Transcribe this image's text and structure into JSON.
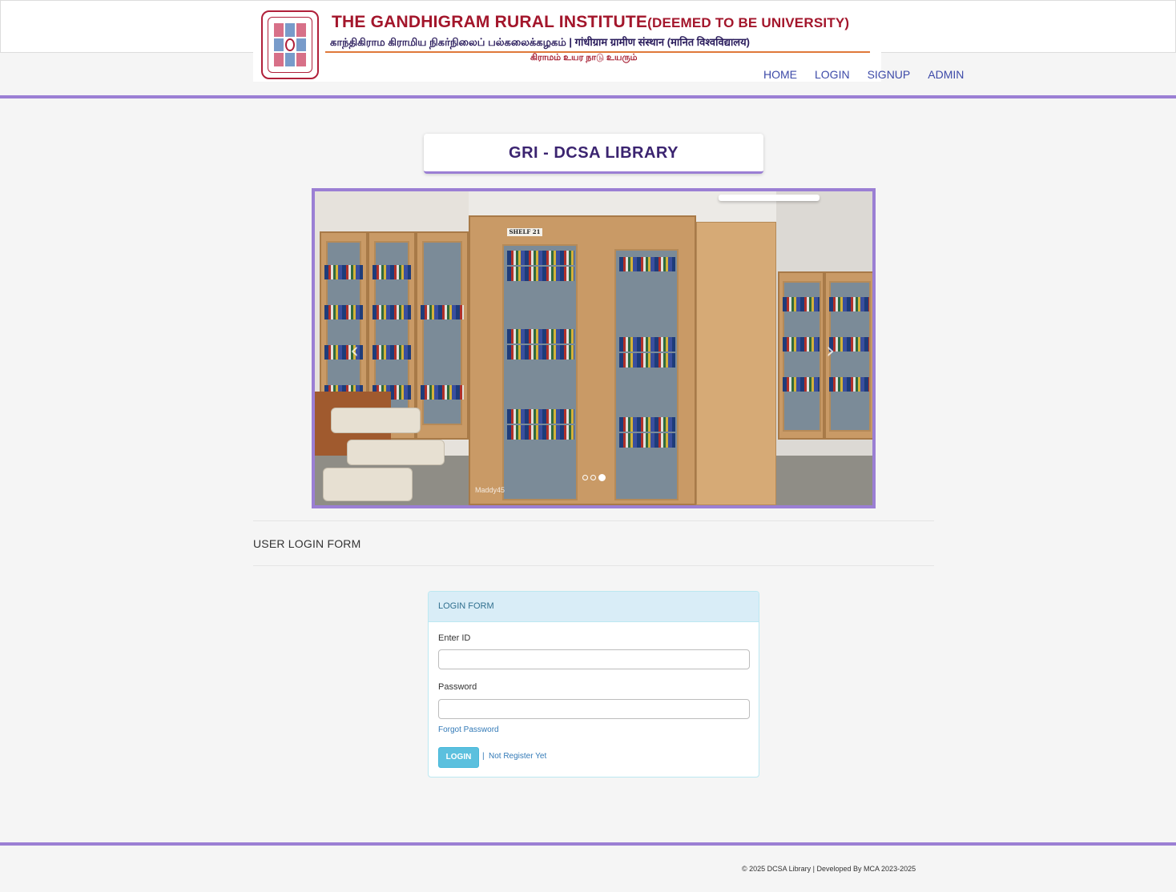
{
  "banner": {
    "title_main": "THE GANDHIGRAM RURAL INSTITUTE",
    "title_suffix": "(DEEMED TO BE UNIVERSITY)",
    "subtitle": "காந்திகிராம கிராமிய நிகர்நிலைப் பல்கலைக்கழகம் | गांधीग्राम ग्रामीण संस्थान (मानित विश्वविद्यालय)",
    "motto": "கிராமம் உயர நாடு உயரும்"
  },
  "nav": {
    "items": [
      {
        "label": "HOME"
      },
      {
        "label": "LOGIN"
      },
      {
        "label": "SIGNUP"
      },
      {
        "label": "ADMIN"
      }
    ]
  },
  "library_title": "GRI - DCSA LIBRARY",
  "carousel": {
    "shelf_tag": "SHELF 21",
    "watermark": "Maddy45",
    "slide_count": 3,
    "active_slide": 3
  },
  "section": {
    "title": "USER LOGIN FORM"
  },
  "login_form": {
    "heading": "LOGIN FORM",
    "id_label": "Enter ID",
    "id_value": "",
    "password_label": "Password",
    "password_value": "",
    "forgot_label": "Forgot Password",
    "login_button": "LOGIN",
    "separator": "|",
    "register_label": "Not Register Yet"
  },
  "footer": {
    "text": "© 2025 DCSA Library | Developed By MCA 2023-2025"
  },
  "colors": {
    "accent": "#9b7fd4",
    "nav_link": "#3d4aa8",
    "title_text": "#3b2470",
    "button": "#5bc0de",
    "panel_heading": "#d9edf7"
  }
}
